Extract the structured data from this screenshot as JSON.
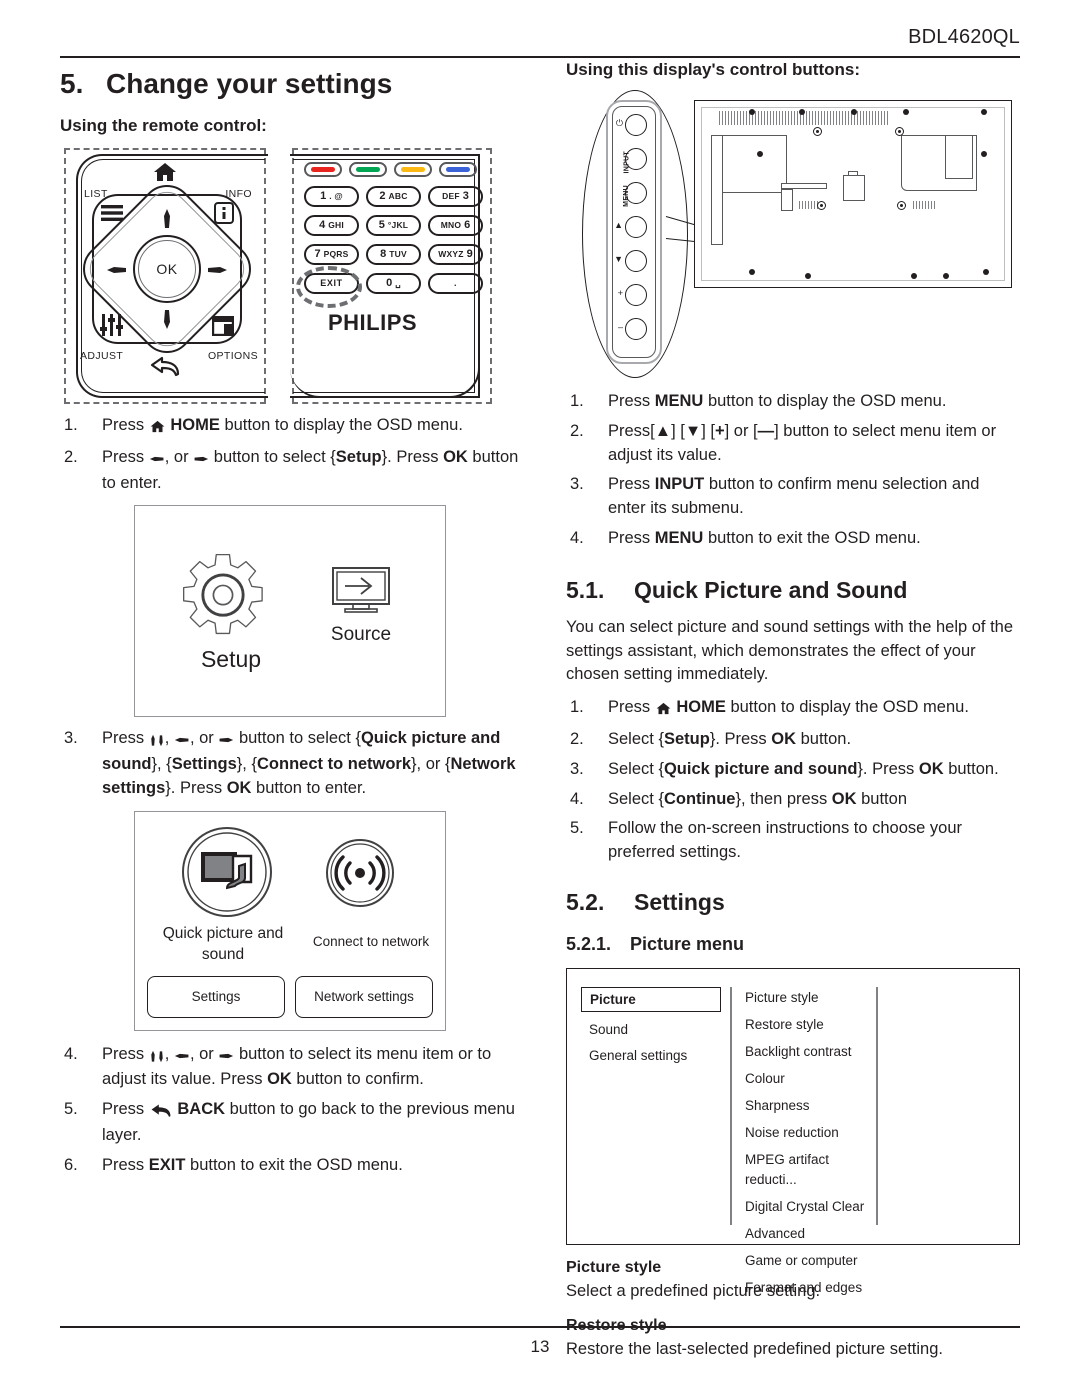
{
  "header": {
    "model": "BDL4620QL"
  },
  "footer": {
    "page_number": "13"
  },
  "left": {
    "chapter_number": "5.",
    "chapter_title": "Change your settings",
    "remote_heading": "Using the remote control:",
    "remote": {
      "labels": {
        "list": "LIST",
        "info": "INFO",
        "adjust": "ADJUST",
        "options": "OPTIONS",
        "ok": "OK"
      },
      "brand": "PHILIPS",
      "color_keys": [
        {
          "name": "red-key",
          "color": "#e8251e"
        },
        {
          "name": "green-key",
          "color": "#00a651"
        },
        {
          "name": "yellow-key",
          "color": "#fcb813"
        },
        {
          "name": "blue-key",
          "color": "#3a63d8"
        }
      ],
      "keypad": [
        {
          "num": "1",
          "sub": ". @",
          "order": "num-first"
        },
        {
          "num": "2",
          "sub": "ABC",
          "order": "num-first"
        },
        {
          "num": "3",
          "sub": "DEF",
          "order": "sub-first"
        },
        {
          "num": "4",
          "sub": "GHI",
          "order": "num-first"
        },
        {
          "num": "5",
          "sub": "°JKL",
          "order": "num-first"
        },
        {
          "num": "6",
          "sub": "MNO",
          "order": "sub-first"
        },
        {
          "num": "7",
          "sub": "PQRS",
          "order": "num-first"
        },
        {
          "num": "8",
          "sub": "TUV",
          "order": "num-first"
        },
        {
          "num": "9",
          "sub": "WXYZ",
          "order": "sub-first"
        },
        {
          "num": "EXIT",
          "sub": "",
          "order": "plain"
        },
        {
          "num": "0",
          "sub": "␣",
          "order": "num-first"
        },
        {
          "num": ".",
          "sub": "",
          "order": "plain"
        }
      ]
    },
    "steps_a": [
      {
        "n": "1.",
        "html": "Press <span class=\"gl\" data-name=\"home-icon\"></span> <b>HOME</b> button to display the OSD menu."
      },
      {
        "n": "2.",
        "html": "Press <span class=\"gl\" data-name=\"arrow-left-icon\"></span>, or <span class=\"gl\" data-name=\"arrow-right-icon\"></span> button to select {<b>Setup</b>}. Press <b>OK</b> button to enter."
      }
    ],
    "setup_figure": {
      "setup_label": "Setup",
      "source_label": "Source"
    },
    "steps_b": [
      {
        "n": "3.",
        "html": "Press <span class=\"gl\" data-name=\"arrow-up-icon\"></span><span class=\"gl\" data-name=\"arrow-down-icon\"></span>, <span class=\"gl\" data-name=\"arrow-left-icon\"></span>, or <span class=\"gl\" data-name=\"arrow-right-icon\"></span> button to select {<b>Quick picture and sound</b>}, {<b>Settings</b>}, {<b>Connect to network</b>}, or {<b>Network settings</b>}. Press <b>OK</b> button to enter."
      }
    ],
    "quick_figure": {
      "label_quick": "Quick picture and sound",
      "label_network": "Connect to network",
      "button_settings": "Settings",
      "button_network_settings": "Network settings"
    },
    "steps_c": [
      {
        "n": "4.",
        "html": "Press <span class=\"gl\" data-name=\"arrow-up-icon\"></span><span class=\"gl\" data-name=\"arrow-down-icon\"></span>, <span class=\"gl\" data-name=\"arrow-left-icon\"></span>, or <span class=\"gl\" data-name=\"arrow-right-icon\"></span> button to select its menu item or to adjust its value. Press <b>OK</b> button to confirm."
      },
      {
        "n": "5.",
        "html": "Press <span class=\"gl\" data-name=\"back-icon\"></span> <b>BACK</b> button to go back to the previous menu layer."
      },
      {
        "n": "6.",
        "html": "Press <b>EXIT</b> button to exit the OSD menu."
      }
    ]
  },
  "right": {
    "control_heading": "Using this display's control buttons:",
    "control_buttons": [
      {
        "name": "power-button",
        "label": "",
        "symbol": "⏻"
      },
      {
        "name": "input-button",
        "label": "INPUT",
        "symbol": ""
      },
      {
        "name": "menu-button",
        "label": "MENU",
        "symbol": ""
      },
      {
        "name": "up-button",
        "label": "",
        "symbol": "▲"
      },
      {
        "name": "down-button",
        "label": "",
        "symbol": "▼"
      },
      {
        "name": "plus-button",
        "label": "",
        "symbol": "+"
      },
      {
        "name": "minus-button",
        "label": "",
        "symbol": "–"
      }
    ],
    "steps": [
      {
        "n": "1.",
        "html": "Press <b>MENU</b> button to display the OSD menu."
      },
      {
        "n": "2.",
        "html": "Press[<b>▲</b>] [<b>▼</b>] [<b>+</b>] or [<b>—</b>] button to select menu item or adjust its value."
      },
      {
        "n": "3.",
        "html": "Press <b>INPUT</b> button to confirm menu selection and enter its submenu."
      },
      {
        "n": "4.",
        "html": "Press <b>MENU</b> button to exit the OSD menu."
      }
    ],
    "sec_51": {
      "number": "5.1.",
      "title": "Quick Picture and Sound",
      "intro": "You can select picture and sound settings with the help of the settings assistant, which demonstrates the effect of your chosen setting immediately.",
      "steps": [
        {
          "n": "1.",
          "html": "Press <span class=\"gl\" data-name=\"home-icon\"></span> <b>HOME</b> button to display the OSD menu."
        },
        {
          "n": "2.",
          "html": "Select {<b>Setup</b>}. Press <b>OK</b> button."
        },
        {
          "n": "3.",
          "html": "Select {<b>Quick picture and sound</b>}. Press <b>OK</b> button."
        },
        {
          "n": "4.",
          "html": "Select {<b>Continue</b>}, then press <b>OK</b> button"
        },
        {
          "n": "5.",
          "html": "Follow the on-screen instructions to choose your preferred settings."
        }
      ]
    },
    "sec_52": {
      "number": "5.2.",
      "title": "Settings"
    },
    "sec_521": {
      "number": "5.2.1.",
      "title": "Picture menu"
    },
    "picture_menu": {
      "left_column": [
        {
          "label": "Picture",
          "selected": true
        },
        {
          "label": "Sound",
          "selected": false
        },
        {
          "label": "General settings",
          "selected": false
        }
      ],
      "middle_column": [
        "Picture style",
        "Restore style",
        "Backlight contrast",
        "Colour",
        "Sharpness",
        "Noise reduction",
        "MPEG artifact reducti...",
        "Digital Crystal Clear",
        "Advanced",
        "Game or computer",
        "Foramat and edges"
      ]
    },
    "definitions": [
      {
        "term": "Picture style",
        "text": "Select a predefined picture setting."
      },
      {
        "term": "Restore style",
        "text": "Restore the last-selected predefined picture setting."
      }
    ]
  }
}
